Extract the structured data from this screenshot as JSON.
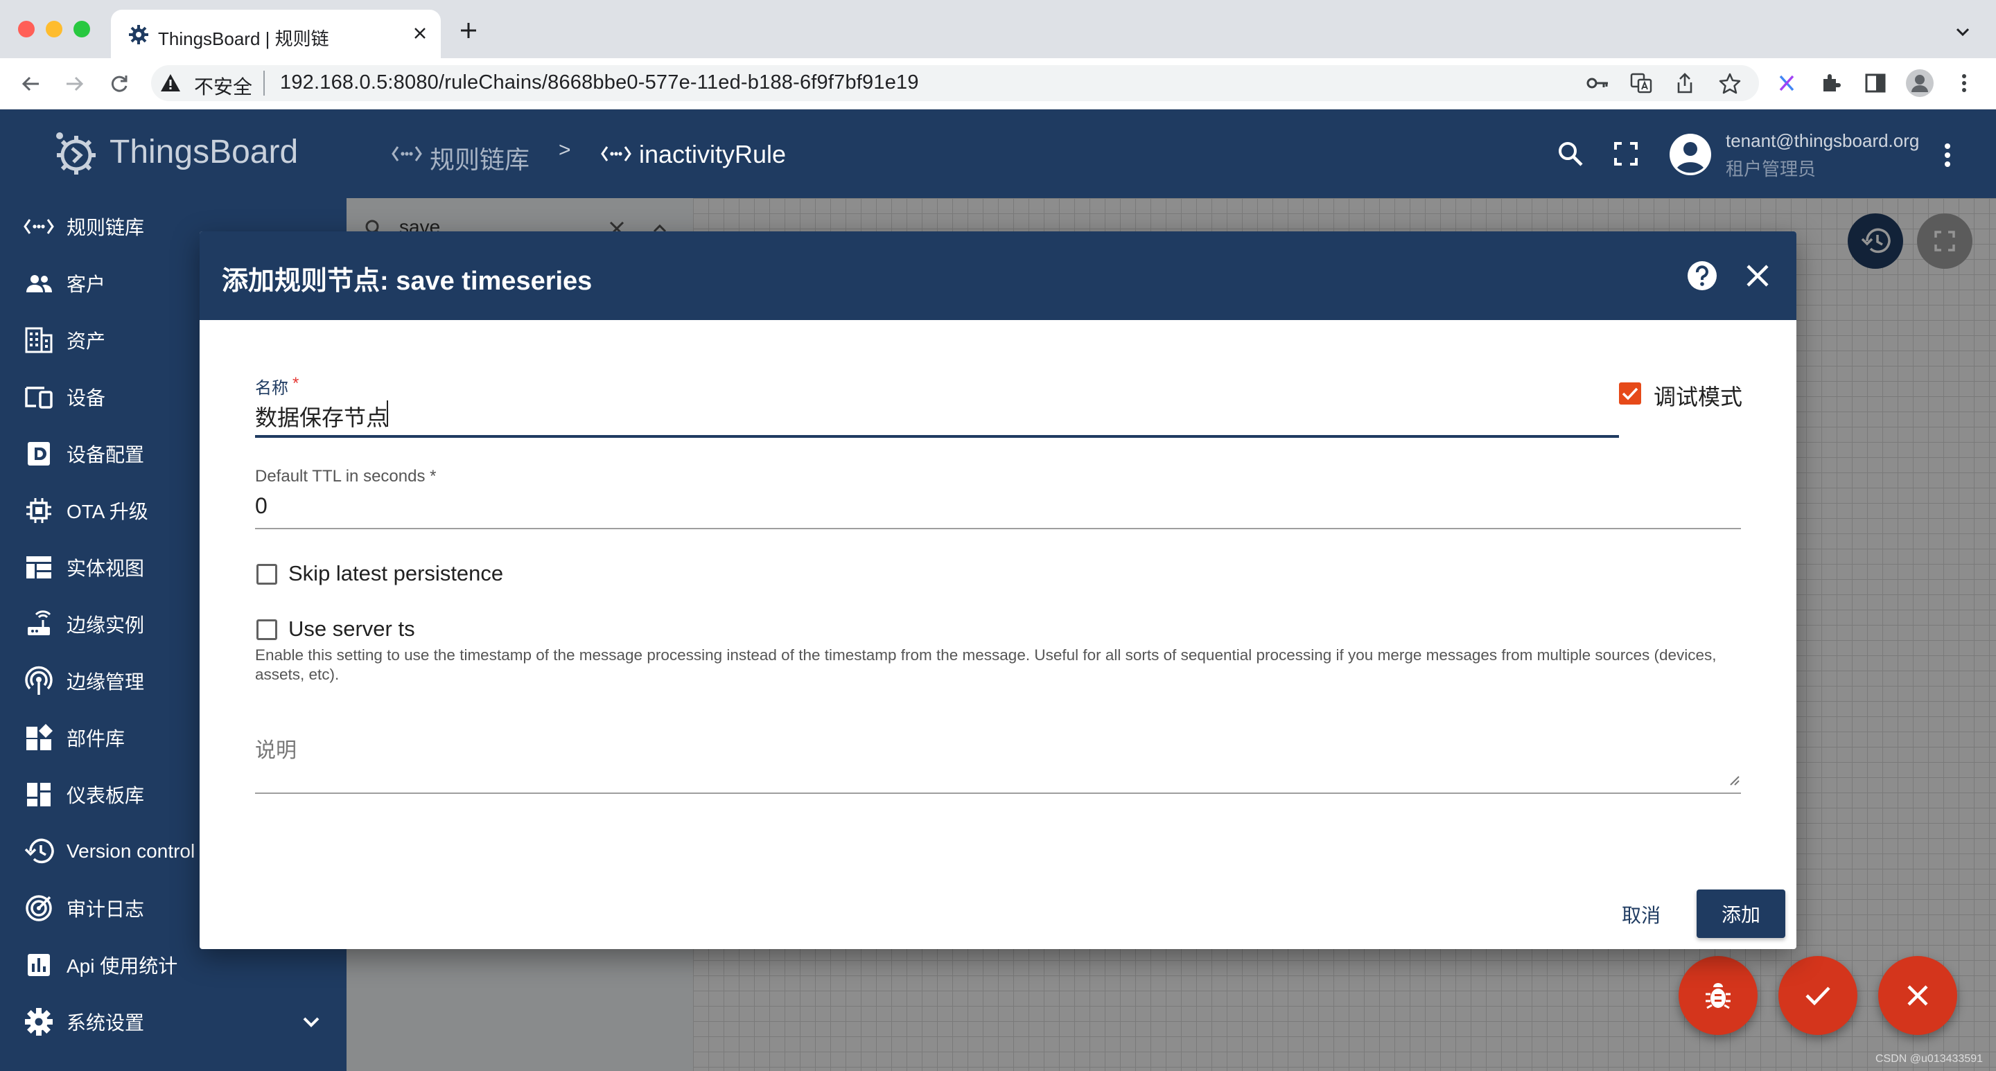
{
  "browser": {
    "tab_title": "ThingsBoard | 规则链",
    "security_label": "不安全",
    "url": "192.168.0.5:8080/ruleChains/8668bbe0-577e-11ed-b188-6f9f7bf91e19"
  },
  "app": {
    "logo_text": "ThingsBoard",
    "breadcrumb": {
      "root": "规则链库",
      "separator": ">",
      "current": "inactivityRule"
    },
    "user": {
      "email": "tenant@thingsboard.org",
      "role": "租户管理员"
    }
  },
  "sidebar": {
    "items": [
      {
        "label": "规则链库",
        "icon": "rule-chain-icon"
      },
      {
        "label": "客户",
        "icon": "customers-icon"
      },
      {
        "label": "资产",
        "icon": "assets-icon"
      },
      {
        "label": "设备",
        "icon": "devices-icon"
      },
      {
        "label": "设备配置",
        "icon": "device-profile-icon"
      },
      {
        "label": "OTA 升级",
        "icon": "ota-chip-icon"
      },
      {
        "label": "实体视图",
        "icon": "entity-view-icon"
      },
      {
        "label": "边缘实例",
        "icon": "router-icon"
      },
      {
        "label": "边缘管理",
        "icon": "edge-tower-icon"
      },
      {
        "label": "部件库",
        "icon": "widgets-icon"
      },
      {
        "label": "仪表板库",
        "icon": "dashboard-icon"
      },
      {
        "label": "Version control",
        "icon": "history-icon"
      },
      {
        "label": "审计日志",
        "icon": "track-changes-icon"
      },
      {
        "label": "Api 使用统计",
        "icon": "bar-chart-icon"
      },
      {
        "label": "系统设置",
        "icon": "settings-icon"
      }
    ]
  },
  "node_search": {
    "value": "save"
  },
  "dialog": {
    "title": "添加规则节点: save timeseries",
    "name_label": "名称",
    "required_mark": "*",
    "name_value": "数据保存节点",
    "debug_mode_label": "调试模式",
    "debug_mode_checked": true,
    "ttl_label": "Default TTL in seconds *",
    "ttl_value": "0",
    "skip_latest_label": "Skip latest persistence",
    "skip_latest_checked": false,
    "server_ts_label": "Use server ts",
    "server_ts_checked": false,
    "server_ts_hint": "Enable this setting to use the timestamp of the message processing instead of the timestamp from the message. Useful for all sorts of sequential processing if you merge messages from multiple sources (devices, assets, etc).",
    "description_placeholder": "说明",
    "cancel_label": "取消",
    "add_label": "添加"
  },
  "watermark": "CSDN @u013433591",
  "colors": {
    "primary": "#1f3b61",
    "accent": "#d4351c",
    "checkbox": "#e64a19"
  }
}
